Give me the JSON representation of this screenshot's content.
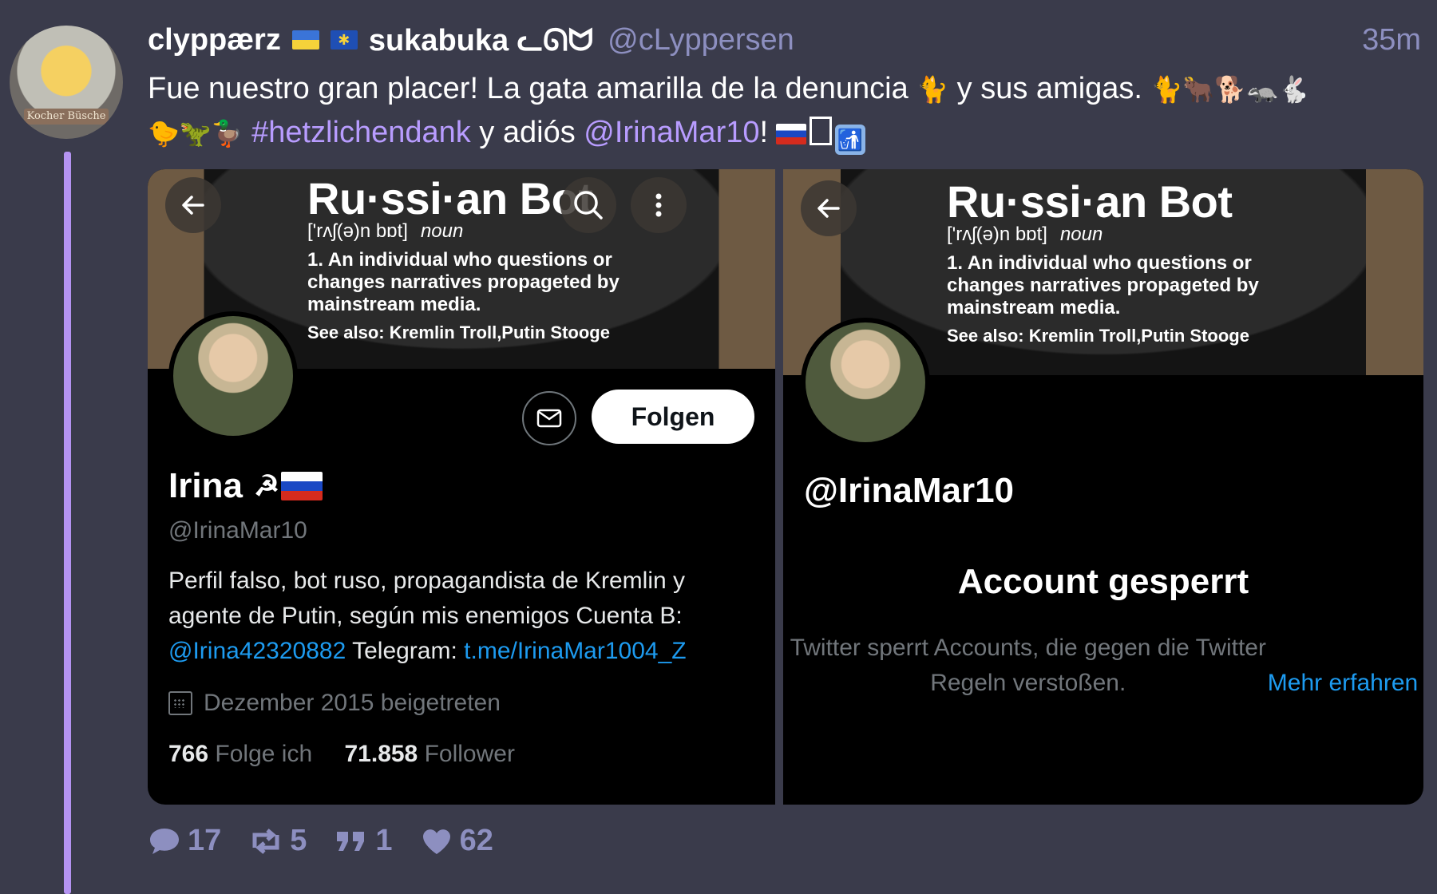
{
  "post": {
    "display_name": "clyppærz",
    "display_name_2": "sukabuka ᓚᘏᗢ",
    "handle": "@cLyppersen",
    "time": "35m",
    "avatar_caption": "Kocher Büsche",
    "text_part1": "Fue nuestro gran placer! La gata amarilla de la denuncia ",
    "emoji1": "🐈",
    "text_part2": " y sus amigas. ",
    "emoji2": "🐈🐂🐕🦡🐇",
    "emoji3": "🐤🦖🦆",
    "hashtag": "#hetzlichendank",
    "text_part3": " y adiós ",
    "mention": "@IrinaMar10",
    "text_part4": "!",
    "trash_glyph": "🚮"
  },
  "left_card": {
    "banner_title": "Ru·ssi·an  Bot",
    "banner_pron": "['rʌʃ(ə)n bɒt]",
    "banner_pos": "noun",
    "banner_def": "1.  An individual who questions or changes narratives propageted by mainstream media.",
    "banner_see": "See also: Kremlin Troll,Putin Stooge",
    "follow_label": "Folgen",
    "name": "Irina",
    "name_symbol": "☭",
    "handle": "@IrinaMar10",
    "bio_text": "Perfil falso, bot ruso, propagandista de Kremlin y agente de Putin, según mis enemigos  Cuenta B: ",
    "bio_link1": "@Irina42320882",
    "bio_text2": "  Telegram: ",
    "bio_link2": "t.me/IrinaMar1004_Z",
    "joined": "Dezember 2015 beigetreten",
    "following_count": "766",
    "following_label": "Folge ich",
    "followers_count": "71.858",
    "followers_label": "Follower"
  },
  "right_card": {
    "banner_title": "Ru·ssi·an  Bot",
    "banner_pron": "['rʌʃ(ə)n bɒt]",
    "banner_pos": "noun",
    "banner_def": "1.  An individual who questions or changes narratives propageted by mainstream media.",
    "banner_see": "See also: Kremlin Troll,Putin Stooge",
    "handle": "@IrinaMar10",
    "suspended_title": "Account gesperrt",
    "suspended_text": "Twitter sperrt Accounts, die gegen die Twitter Regeln verstoßen. ",
    "learn_more": "Mehr erfahren"
  },
  "actions": {
    "replies": "17",
    "boosts": "5",
    "quotes": "1",
    "likes": "62"
  }
}
